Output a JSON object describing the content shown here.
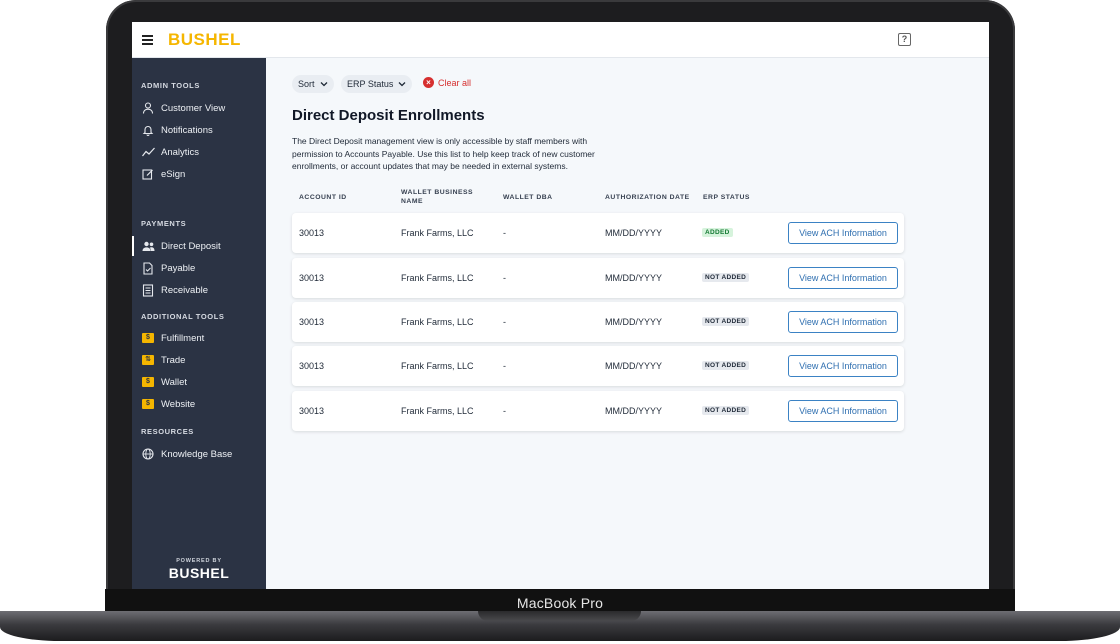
{
  "device": {
    "label": "MacBook Pro"
  },
  "topbar": {
    "logo": "BUSHEL",
    "help_icon": "help-icon"
  },
  "sidebar": {
    "sections": [
      {
        "title": "ADMIN TOOLS",
        "items": [
          {
            "label": "Customer View",
            "icon": "user-icon"
          },
          {
            "label": "Notifications",
            "icon": "bell-icon"
          },
          {
            "label": "Analytics",
            "icon": "trend-icon"
          },
          {
            "label": "eSign",
            "icon": "edit-icon"
          }
        ]
      },
      {
        "title": "PAYMENTS",
        "items": [
          {
            "label": "Direct Deposit",
            "icon": "users-icon",
            "active": true
          },
          {
            "label": "Payable",
            "icon": "document-icon"
          },
          {
            "label": "Receivable",
            "icon": "list-document-icon"
          }
        ]
      },
      {
        "title": "ADDITIONAL TOOLS",
        "items": [
          {
            "label": "Fulfillment",
            "icon": "fulfillment-icon"
          },
          {
            "label": "Trade",
            "icon": "trade-icon"
          },
          {
            "label": "Wallet",
            "icon": "wallet-icon"
          },
          {
            "label": "Website",
            "icon": "website-icon"
          }
        ]
      },
      {
        "title": "RESOURCES",
        "items": [
          {
            "label": "Knowledge Base",
            "icon": "globe-icon"
          }
        ]
      }
    ],
    "powered_by": "POWERED BY",
    "powered_logo": "BUSHEL"
  },
  "filters": {
    "sort": "Sort",
    "erp_status": "ERP Status",
    "clear_all": "Clear all"
  },
  "page": {
    "title": "Direct Deposit Enrollments",
    "description": "The Direct Deposit management view is only accessible by staff members with permission to Accounts Payable. Use this list to help keep track of new customer enrollments, or account updates that may be needed in external systems."
  },
  "table": {
    "headers": [
      "ACCOUNT ID",
      "WALLET BUSINESS NAME",
      "WALLET DBA",
      "AUTHORIZATION DATE",
      "ERP STATUS"
    ],
    "rows": [
      {
        "account_id": "30013",
        "business_name": "Frank Farms, LLC",
        "dba": "-",
        "auth_date": "MM/DD/YYYY",
        "status": "ADDED",
        "action": "View ACH Information"
      },
      {
        "account_id": "30013",
        "business_name": "Frank Farms, LLC",
        "dba": "-",
        "auth_date": "MM/DD/YYYY",
        "status": "NOT ADDED",
        "action": "View ACH Information"
      },
      {
        "account_id": "30013",
        "business_name": "Frank Farms, LLC",
        "dba": "-",
        "auth_date": "MM/DD/YYYY",
        "status": "NOT ADDED",
        "action": "View ACH Information"
      },
      {
        "account_id": "30013",
        "business_name": "Frank Farms, LLC",
        "dba": "-",
        "auth_date": "MM/DD/YYYY",
        "status": "NOT ADDED",
        "action": "View ACH Information"
      },
      {
        "account_id": "30013",
        "business_name": "Frank Farms, LLC",
        "dba": "-",
        "auth_date": "MM/DD/YYYY",
        "status": "NOT ADDED",
        "action": "View ACH Information"
      }
    ]
  },
  "colors": {
    "sidebar": "#2b3344",
    "brand_yellow": "#f5b600",
    "link_blue": "#2f6fb0",
    "danger": "#d62f2f",
    "added_green": "#157a34"
  }
}
